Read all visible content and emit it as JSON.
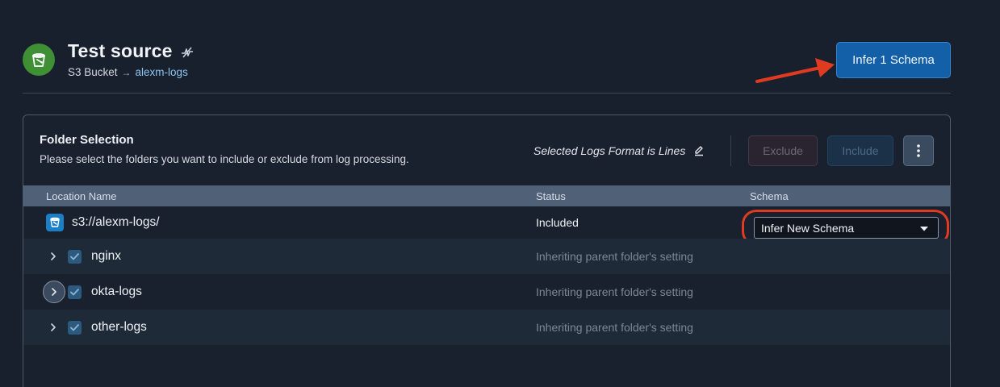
{
  "header": {
    "title": "Test source",
    "breadcrumb_type": "S3 Bucket",
    "breadcrumb_arrow": "→",
    "breadcrumb_link": "alexm-logs",
    "source_icon": "bucket-icon",
    "status_icon": "pulse-off-icon",
    "infer_button_label": "Infer 1 Schema"
  },
  "panel": {
    "title": "Folder Selection",
    "description": "Please select the folders you want to include or exclude from log processing.",
    "format_label": "Selected Logs Format is Lines",
    "exclude_label": "Exclude",
    "include_label": "Include"
  },
  "table": {
    "columns": [
      "Location Name",
      "Status",
      "Schema"
    ],
    "root": {
      "name": "s3://alexm-logs/",
      "status": "Included",
      "schema": "Infer New Schema"
    },
    "rows": [
      {
        "name": "nginx",
        "status": "Inheriting parent folder's setting",
        "checked": true
      },
      {
        "name": "okta-logs",
        "status": "Inheriting parent folder's setting",
        "checked": true
      },
      {
        "name": "other-logs",
        "status": "Inheriting parent folder's setting",
        "checked": true
      }
    ]
  },
  "colors": {
    "accent": "#1360a8",
    "annotation": "#e03b21",
    "source_green": "#3f8f34"
  }
}
